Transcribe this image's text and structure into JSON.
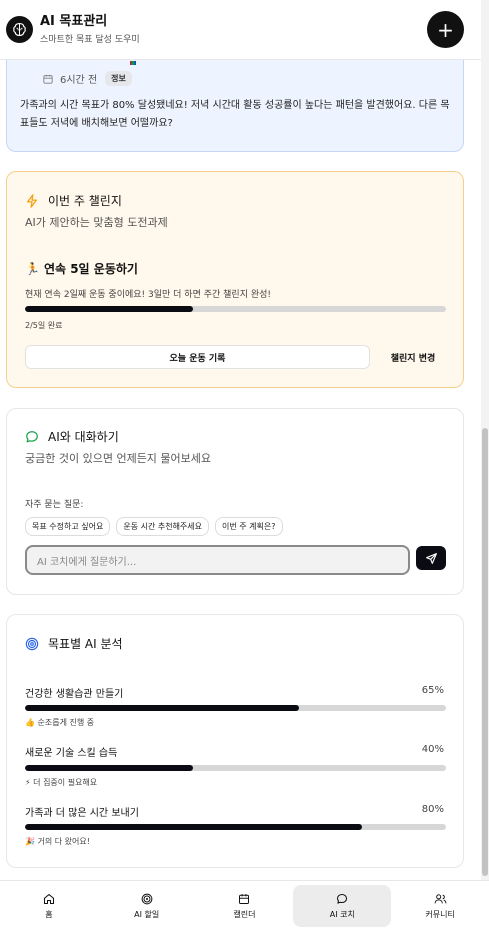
{
  "header": {
    "title": "AI 목표관리",
    "subtitle": "스마트한 목표 달성 도우미",
    "add_icon": "plus-icon"
  },
  "info_card": {
    "time": "6시간 전",
    "badge": "정보",
    "message": "가족과의 시간 목표가 80% 달성됐네요! 저녁 시간대 활동 성공률이 높다는 패턴을 발견했어요. 다른 목표들도 저녁에 배치해보면 어떨까요?"
  },
  "challenge": {
    "title": "이번 주 챌린지",
    "subtitle": "AI가 제안하는 맞춤형 도전과제",
    "emoji": "🏃",
    "name": "연속 5일 운동하기",
    "description": "현재 연속 2일째 운동 중이에요! 3일만 더 하면 주간 챌린지 완성!",
    "progress": 0.4,
    "progress_label": "2/5일 완료",
    "record_button": "오늘 운동 기록",
    "change_button": "챌린지 변경",
    "accent": "#f59e0b"
  },
  "chat": {
    "title": "AI와 대화하기",
    "subtitle": "궁금한 것이 있으면 언제든지 물어보세요",
    "faq_label": "자주 묻는 질문:",
    "chips": [
      "목표 수정하고 싶어요",
      "운동 시간 추천해주세요",
      "이번 주 계획은?"
    ],
    "input_placeholder": "AI 코치에게 질문하기...",
    "accent": "#16a34a"
  },
  "analysis": {
    "title": "목표별 AI 분석",
    "accent": "#2563eb",
    "goals": [
      {
        "name": "건강한 생활습관 만들기",
        "percent_label": "65%",
        "progress": 0.65,
        "emoji": "👍",
        "note": "순조롭게 진행 중"
      },
      {
        "name": "새로운 기술 스킬 습득",
        "percent_label": "40%",
        "progress": 0.4,
        "emoji": "⚡",
        "note": "더 집중이 필요해요"
      },
      {
        "name": "가족과 더 많은 시간 보내기",
        "percent_label": "80%",
        "progress": 0.8,
        "emoji": "🎉",
        "note": "거의 다 왔어요!"
      }
    ]
  },
  "nav": {
    "items": [
      {
        "label": "홈",
        "icon": "home-icon"
      },
      {
        "label": "AI 할일",
        "icon": "target-icon"
      },
      {
        "label": "캘린더",
        "icon": "calendar-icon"
      },
      {
        "label": "AI 코치",
        "icon": "chat-icon",
        "active": true
      },
      {
        "label": "커뮤니티",
        "icon": "users-icon"
      }
    ]
  }
}
